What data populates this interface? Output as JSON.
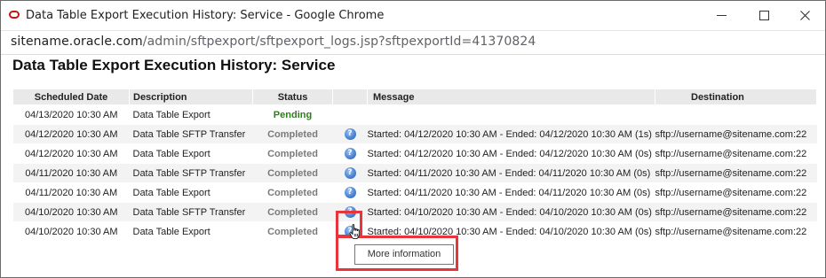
{
  "window": {
    "title": "Data Table Export Execution History: Service - Google Chrome",
    "url_host": "sitename.oracle.com",
    "url_path": "/admin/sftpexport/sftpexport_logs.jsp?sftpexportId=41370824"
  },
  "page": {
    "heading": "Data Table Export Execution History: Service"
  },
  "table": {
    "headers": {
      "scheduled": "Scheduled Date",
      "description": "Description",
      "status": "Status",
      "message": "Message",
      "destination": "Destination"
    },
    "rows": [
      {
        "date": "04/13/2020 10:30 AM",
        "desc": "Data Table Export",
        "status": "Pending",
        "message": "",
        "dest": ""
      },
      {
        "date": "04/12/2020 10:30 AM",
        "desc": "Data Table SFTP Transfer",
        "status": "Completed",
        "message": "Started: 04/12/2020 10:30 AM - Ended: 04/12/2020 10:30 AM (1s)",
        "dest": "sftp://username@sitename.com:22"
      },
      {
        "date": "04/12/2020 10:30 AM",
        "desc": "Data Table Export",
        "status": "Completed",
        "message": "Started: 04/12/2020 10:30 AM - Ended: 04/12/2020 10:30 AM (0s)",
        "dest": "sftp://username@sitename.com:22"
      },
      {
        "date": "04/11/2020 10:30 AM",
        "desc": "Data Table SFTP Transfer",
        "status": "Completed",
        "message": "Started: 04/11/2020 10:30 AM - Ended: 04/11/2020 10:30 AM (0s)",
        "dest": "sftp://username@sitename.com:22"
      },
      {
        "date": "04/11/2020 10:30 AM",
        "desc": "Data Table Export",
        "status": "Completed",
        "message": "Started: 04/11/2020 10:30 AM - Ended: 04/11/2020 10:30 AM (0s)",
        "dest": "sftp://username@sitename.com:22"
      },
      {
        "date": "04/10/2020 10:30 AM",
        "desc": "Data Table SFTP Transfer",
        "status": "Completed",
        "message": "Started: 04/10/2020 10:30 AM - Ended: 04/10/2020 10:30 AM (0s)",
        "dest": "sftp://username@sitename.com:22"
      },
      {
        "date": "04/10/2020 10:30 AM",
        "desc": "Data Table Export",
        "status": "Completed",
        "message": "Started: 04/10/2020 10:30 AM - Ended: 04/10/2020 10:30 AM (0s)",
        "dest": "sftp://username@sitename.com:22"
      }
    ]
  },
  "tooltip": {
    "text": "More information"
  },
  "colors": {
    "pending": "#2e7d1e",
    "completed": "#7a7a7a",
    "highlight": "#e8353b",
    "info_icon": "#4d84d4"
  },
  "icons": {
    "app": "oracle-logo-icon",
    "info": "info-icon",
    "cursor": "hand-pointer-icon"
  }
}
